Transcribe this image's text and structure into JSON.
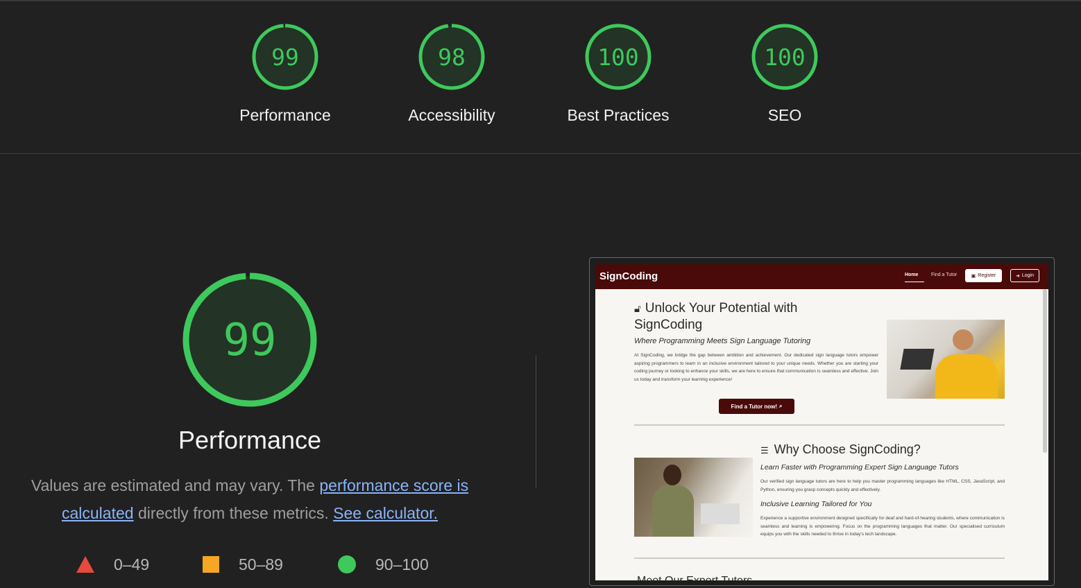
{
  "scores": [
    {
      "label": "Performance",
      "value": "99",
      "score": 99,
      "color": "#3ec95c"
    },
    {
      "label": "Accessibility",
      "value": "98",
      "score": 98,
      "color": "#3ec95c"
    },
    {
      "label": "Best Practices",
      "value": "100",
      "score": 100,
      "color": "#3ec95c"
    },
    {
      "label": "SEO",
      "value": "100",
      "score": 100,
      "color": "#3ec95c"
    }
  ],
  "main": {
    "score": "99",
    "score_value": 99,
    "title": "Performance",
    "desc_prefix": "Values are estimated and may vary. The ",
    "desc_link1": "performance score is calculated",
    "desc_mid": " directly from these metrics. ",
    "desc_link2": "See calculator."
  },
  "legend": [
    {
      "range": "0–49",
      "icon": "triangle-icon",
      "color": "#e64a3c"
    },
    {
      "range": "50–89",
      "icon": "square-icon",
      "color": "#f5a623"
    },
    {
      "range": "90–100",
      "icon": "circle-icon",
      "color": "#3ec95c"
    }
  ],
  "screenshot": {
    "brand": "SignCoding",
    "nav_home": "Home",
    "nav_find": "Find a Tutor",
    "nav_register": "Register",
    "nav_login": "Login",
    "hero_title": "Unlock Your Potential with SignCoding",
    "hero_subtitle": "Where Programming Meets Sign Language Tutoring",
    "hero_body": "At SignCoding, we bridge the gap between ambition and achievement. Our dedicated sign language tutors empower aspiring programmers to learn in an inclusive environment tailored to your unique needs. Whether you are starting your coding journey or looking to enhance your skills, we are here to ensure that communication is seamless and effective. Join us today and transform your learning experience!",
    "cta": "Find a Tutor now!",
    "why_title": "Why Choose SignCoding?",
    "why_sub1": "Learn Faster with Programming Expert Sign Language Tutors",
    "why_body1": "Our verified sign language tutors are here to help you master programming languages like HTML, CSS, JavaScript, and Python, ensuring you grasp concepts quickly and effectively.",
    "why_sub2": "Inclusive Learning Tailored for You",
    "why_body2": "Experience a supportive environment designed specifically for deaf and hard-of-hearing students, where communication is seamless and learning is empowering. Focus on the programming languages that matter. Our specialised curriculum equips you with the skills needed to thrive in today's tech landscape.",
    "cut_heading": "Meet Our Expert Tutors"
  },
  "theme": {
    "background": "#212121",
    "pass_green": "#3ec95c",
    "link_blue": "#8ab4f8",
    "site_brand": "#4a0a0a"
  }
}
